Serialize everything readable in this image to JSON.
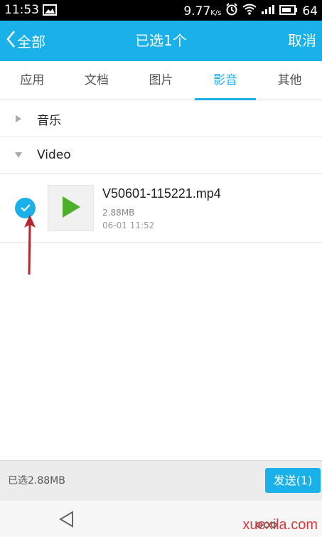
{
  "status_bar": {
    "time": "11:53",
    "speed": "9.77",
    "speed_unit": "K/s",
    "battery": "64"
  },
  "header": {
    "back_label": "全部",
    "title": "已选1个",
    "cancel_label": "取消"
  },
  "tabs": [
    {
      "label": "应用",
      "active": false
    },
    {
      "label": "文档",
      "active": false
    },
    {
      "label": "图片",
      "active": false
    },
    {
      "label": "影音",
      "active": true
    },
    {
      "label": "其他",
      "active": false
    }
  ],
  "groups": [
    {
      "label": "音乐",
      "expanded": false
    },
    {
      "label": "Video",
      "expanded": true
    }
  ],
  "file": {
    "name": "V50601-115221.mp4",
    "size": "2.88MB",
    "date": "06-01 11:52",
    "selected": true
  },
  "footer": {
    "selected_size": "已选2.88MB",
    "send_label": "发送(1)"
  },
  "watermark": "xuexila.com",
  "colors": {
    "accent": "#1ab0ea",
    "play_green": "#4caf2a",
    "arrow_red": "#b3262e"
  }
}
